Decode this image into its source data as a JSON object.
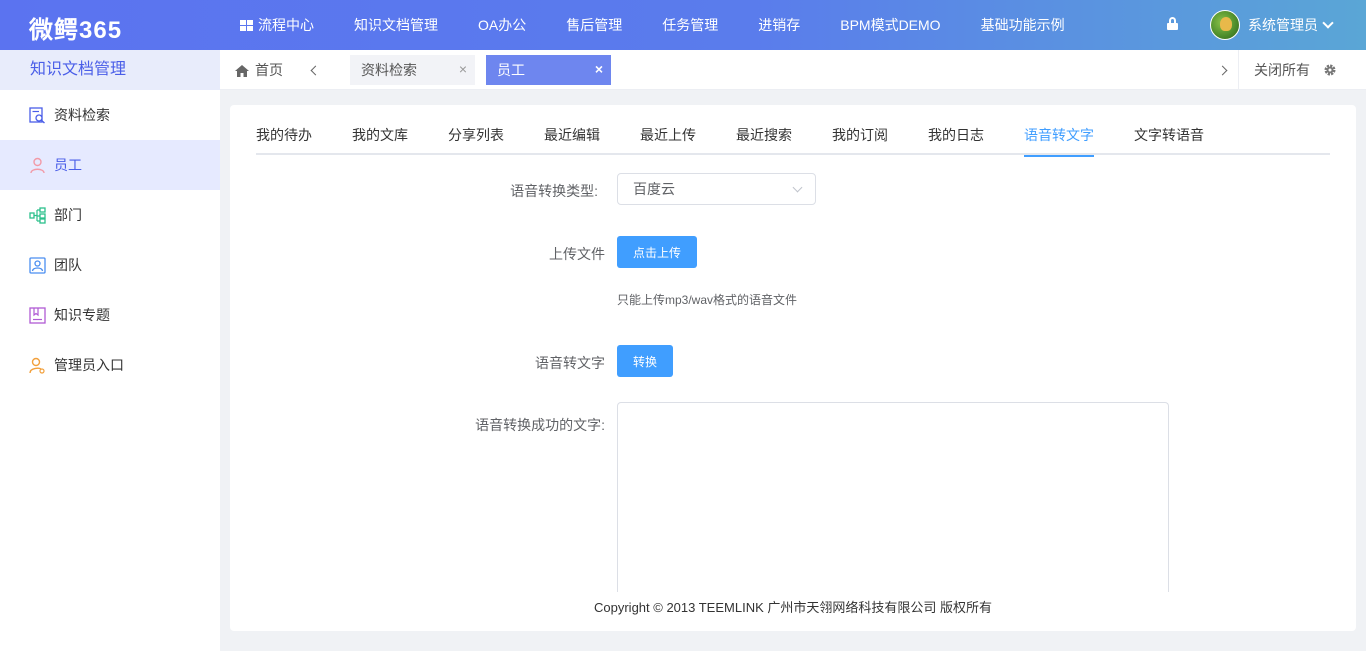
{
  "app": {
    "logo": "微鳄365"
  },
  "topnav": {
    "items": [
      {
        "label": "流程中心"
      },
      {
        "label": "知识文档管理"
      },
      {
        "label": "OA办公"
      },
      {
        "label": "售后管理"
      },
      {
        "label": "任务管理"
      },
      {
        "label": "进销存"
      },
      {
        "label": "BPM模式DEMO"
      },
      {
        "label": "基础功能示例"
      }
    ],
    "user": {
      "name": "系统管理员"
    }
  },
  "sidebar": {
    "title": "知识文档管理",
    "items": [
      {
        "label": "资料检索",
        "icon": "search-doc-icon",
        "color": "#4a5ee8"
      },
      {
        "label": "员工",
        "icon": "person-icon",
        "color": "#f29aa7",
        "active": true
      },
      {
        "label": "部门",
        "icon": "org-chart-icon",
        "color": "#2bc08b"
      },
      {
        "label": "团队",
        "icon": "team-icon",
        "color": "#4a8ef0"
      },
      {
        "label": "知识专题",
        "icon": "book-icon",
        "color": "#b05bd4"
      },
      {
        "label": "管理员入口",
        "icon": "admin-user-icon",
        "color": "#f2a03c"
      }
    ]
  },
  "tabbar": {
    "home": "首页",
    "tabs": [
      {
        "label": "资料检索",
        "close": "×"
      },
      {
        "label": "员工",
        "close": "×",
        "active": true
      }
    ],
    "close_all": "关闭所有"
  },
  "subtabs": {
    "items": [
      {
        "label": "我的待办"
      },
      {
        "label": "我的文库"
      },
      {
        "label": "分享列表"
      },
      {
        "label": "最近编辑"
      },
      {
        "label": "最近上传"
      },
      {
        "label": "最近搜索"
      },
      {
        "label": "我的订阅"
      },
      {
        "label": "我的日志"
      },
      {
        "label": "语音转文字",
        "active": true
      },
      {
        "label": "文字转语音"
      }
    ]
  },
  "form": {
    "type_label": "语音转换类型:",
    "type_value": "百度云",
    "upload_label": "上传文件",
    "upload_button": "点击上传",
    "upload_tip": "只能上传mp3/wav格式的语音文件",
    "convert_label": "语音转文字",
    "convert_button": "转换",
    "result_label": "语音转换成功的文字:",
    "result_value": ""
  },
  "footer": {
    "copyright": "Copyright © 2013 TEEMLINK 广州市天翎网络科技有限公司 版权所有"
  },
  "colors": {
    "accent": "#409eff",
    "brand": "#4a5ee8",
    "active_tab": "#6e86ef"
  }
}
